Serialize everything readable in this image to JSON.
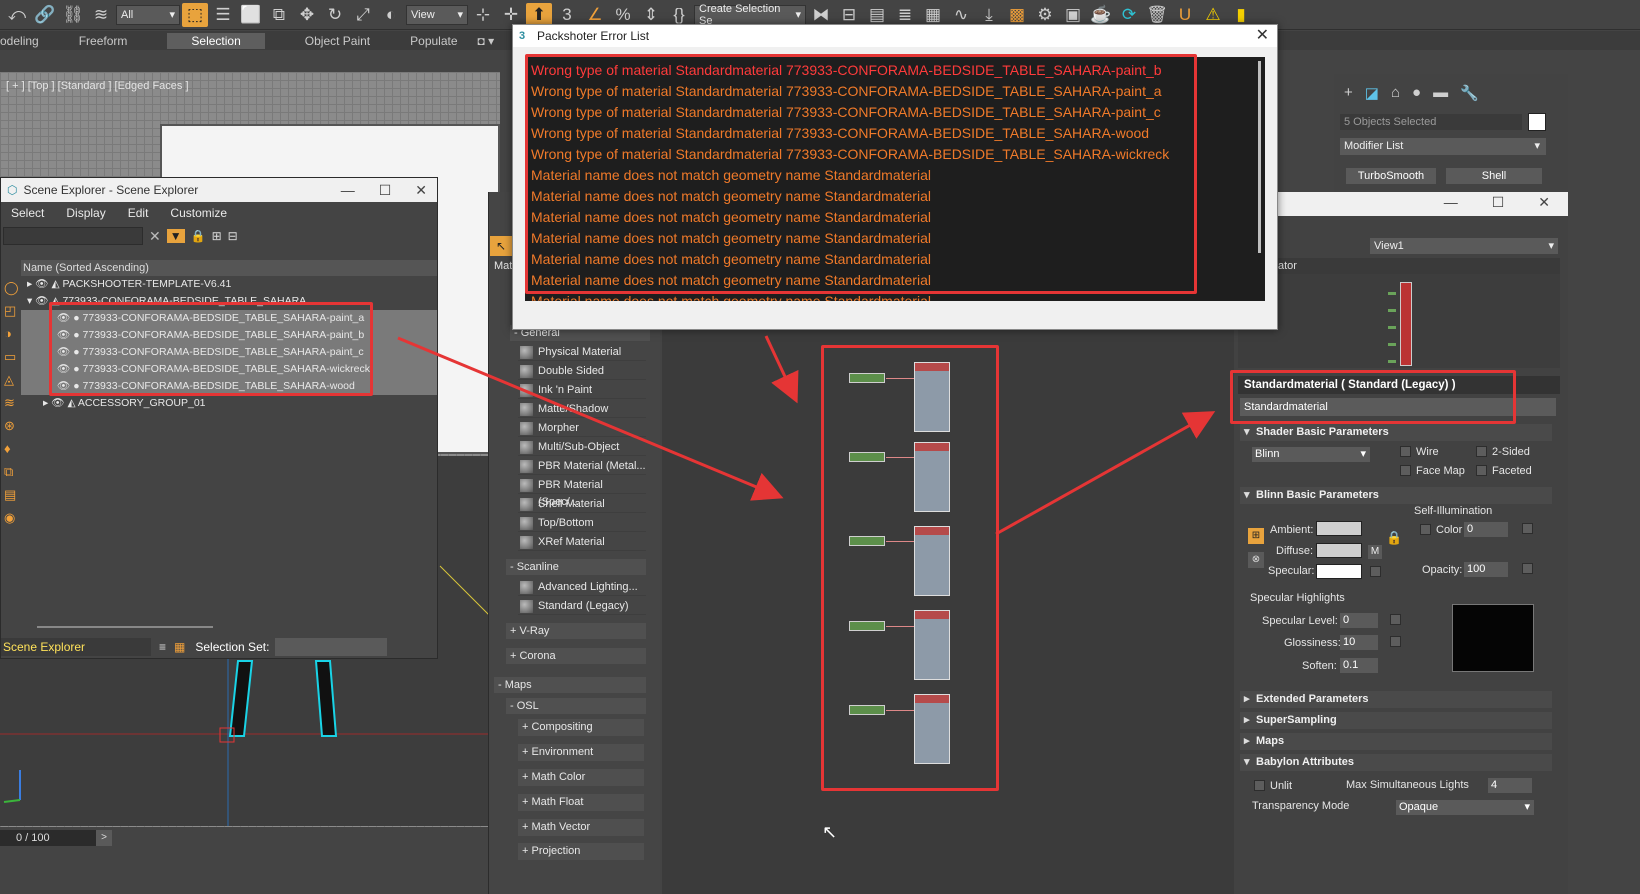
{
  "toolbar": {
    "filter_select": "All",
    "view_select": "View",
    "create_selection_set": "Create Selection Se"
  },
  "ribbon": {
    "tabs": [
      "odeling",
      "Freeform",
      "Selection",
      "Object Paint",
      "Populate"
    ],
    "active": "Selection"
  },
  "viewport": {
    "label": "[ + ] [Top ] [Standard ] [Edged Faces ]",
    "frames": "0 / 100",
    "next": ">"
  },
  "scene_explorer": {
    "title": "Scene Explorer - Scene Explorer",
    "menu": [
      "Select",
      "Display",
      "Edit",
      "Customize"
    ],
    "column_header": "Name (Sorted Ascending)",
    "rows": [
      {
        "label": "PACKSHOOTER-TEMPLATE-V6.41"
      },
      {
        "label": "773933-CONFORAMA-BEDSIDE_TABLE_SAHARA"
      },
      {
        "label": "773933-CONFORAMA-BEDSIDE_TABLE_SAHARA-paint_a"
      },
      {
        "label": "773933-CONFORAMA-BEDSIDE_TABLE_SAHARA-paint_b"
      },
      {
        "label": "773933-CONFORAMA-BEDSIDE_TABLE_SAHARA-paint_c"
      },
      {
        "label": "773933-CONFORAMA-BEDSIDE_TABLE_SAHARA-wickreck"
      },
      {
        "label": "773933-CONFORAMA-BEDSIDE_TABLE_SAHARA-wood"
      },
      {
        "label": "ACCESSORY_GROUP_01"
      }
    ],
    "footer_label": "Scene Explorer",
    "selection_set_label": "Selection Set:"
  },
  "material_browser": {
    "tab_label": "Mat",
    "general_header": "- General",
    "general_items": [
      "Physical Material",
      "Double Sided",
      "Ink 'n Paint",
      "Matte/Shadow",
      "Morpher",
      "Multi/Sub-Object",
      "PBR Material (Metal...",
      "PBR Material (Spec/...",
      "Shell Material",
      "Top/Bottom",
      "XRef Material"
    ],
    "scanline_header": "- Scanline",
    "scanline_items": [
      "Advanced Lighting...",
      "Standard (Legacy)"
    ],
    "vray": "+ V-Ray",
    "corona": "+ Corona",
    "maps_header": "- Maps",
    "osl_header": "- OSL",
    "osl_items": [
      "+ Compositing",
      "+ Environment",
      "+ Math Color",
      "+ Math Float",
      "+ Math Vector",
      "+ Projection"
    ]
  },
  "command_panel": {
    "objects_selected": "5 Objects Selected",
    "modifier_list": "Modifier List",
    "buttons": [
      "TurboSmooth",
      "Shell"
    ]
  },
  "slate": {
    "view_select": "View1",
    "navigator_label": "ator",
    "material_header": "Standardmaterial  ( Standard (Legacy) )",
    "material_name": "Standardmaterial",
    "shader_rollout": "Shader Basic Parameters",
    "shader_type": "Blinn",
    "wire": "Wire",
    "two_sided": "2-Sided",
    "face_map": "Face Map",
    "faceted": "Faceted",
    "blinn_rollout": "Blinn Basic Parameters",
    "self_illum": "Self-Illumination",
    "color_label": "Color",
    "color_value": "0",
    "ambient": "Ambient:",
    "diffuse": "Diffuse:",
    "specular": "Specular:",
    "m_button": "M",
    "opacity_label": "Opacity:",
    "opacity_value": "100",
    "spec_highlights": "Specular Highlights",
    "spec_level_label": "Specular Level:",
    "spec_level_value": "0",
    "gloss_label": "Glossiness:",
    "gloss_value": "10",
    "soften_label": "Soften:",
    "soften_value": "0.1",
    "extended": "Extended Parameters",
    "supersampling": "SuperSampling",
    "maps": "Maps",
    "babylon": "Babylon Attributes",
    "unlit": "Unlit",
    "max_lights_label": "Max Simultaneous Lights",
    "max_lights_value": "4",
    "transparency_label": "Transparency Mode",
    "transparency_value": "Opaque"
  },
  "error_dialog": {
    "title": "Packshoter Error List",
    "close": "✕",
    "errors": [
      {
        "text": "Wrong type of material  Standardmaterial  773933-CONFORAMA-BEDSIDE_TABLE_SAHARA-paint_b",
        "first": true
      },
      {
        "text": "Wrong type of material  Standardmaterial  773933-CONFORAMA-BEDSIDE_TABLE_SAHARA-paint_a"
      },
      {
        "text": "Wrong type of material  Standardmaterial  773933-CONFORAMA-BEDSIDE_TABLE_SAHARA-paint_c"
      },
      {
        "text": "Wrong type of material  Standardmaterial  773933-CONFORAMA-BEDSIDE_TABLE_SAHARA-wood"
      },
      {
        "text": "Wrong type of material  Standardmaterial  773933-CONFORAMA-BEDSIDE_TABLE_SAHARA-wickreck"
      },
      {
        "text": "Material name does not match geometry name Standardmaterial"
      },
      {
        "text": "Material name does not match geometry name Standardmaterial"
      },
      {
        "text": "Material name does not match geometry name Standardmaterial"
      },
      {
        "text": "Material name does not match geometry name Standardmaterial"
      },
      {
        "text": "Material name does not match geometry name Standardmaterial"
      },
      {
        "text": "Material name does not match geometry name Standardmaterial"
      },
      {
        "text": "Material name does not match geometry name Standardmaterial"
      }
    ]
  },
  "colors": {
    "accent_orange": "#f07a2a",
    "error_red": "#ff3b3b",
    "annotation_red": "#e53535"
  }
}
